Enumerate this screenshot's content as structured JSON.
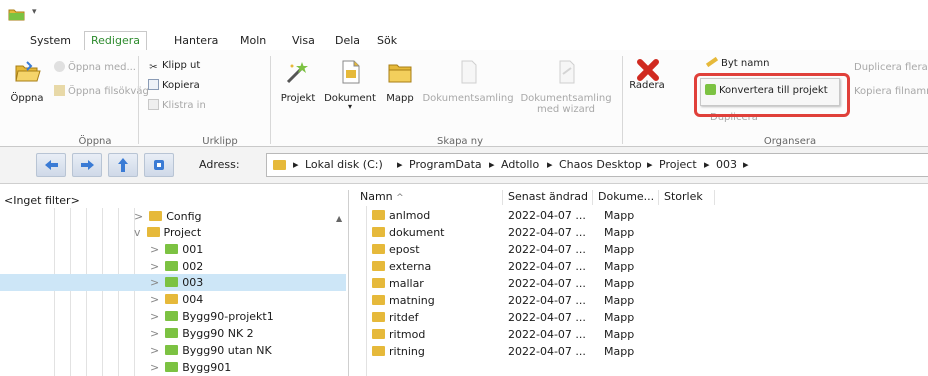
{
  "quick_access": {
    "app_icon": "folder-app-icon",
    "overflow": "▾"
  },
  "tabs": [
    {
      "label": "System"
    },
    {
      "label": "Redigera"
    },
    {
      "label": "Hantera"
    },
    {
      "label": "Moln"
    },
    {
      "label": "Visa"
    },
    {
      "label": "Dela"
    },
    {
      "label": "Sök"
    }
  ],
  "ribbon": {
    "oppna_group": {
      "label": "Öppna",
      "open": "Öppna",
      "open_with": "Öppna med...",
      "open_path": "Öppna filsökväg"
    },
    "urklipp_group": {
      "label": "Urklipp",
      "cut": "Klipp ut",
      "copy": "Kopiera",
      "paste": "Klistra in"
    },
    "skapa_group": {
      "label": "Skapa ny",
      "project": "Projekt",
      "document": "Dokument",
      "folder": "Mapp",
      "doc_collection": "Dokumentsamling",
      "doc_collection_wizard_1": "Dokumentsamling",
      "doc_collection_wizard_2": "med wizard"
    },
    "organisera_group": {
      "label": "Organsera",
      "delete": "Radera",
      "rename": "Byt namn",
      "duplicate": "Duplicera",
      "convert": "Konvertera till projekt",
      "duplicate_multiple": "Duplicera flera",
      "copy_filename": "Kopiera filnamn"
    }
  },
  "nav": {
    "address_label": "Adress:",
    "crumbs": [
      "Lokal disk (C:)",
      "ProgramData",
      "Adtollo",
      "Chaos Desktop",
      "Project",
      "003"
    ],
    "sep": "▸"
  },
  "tree": {
    "filter": "<Inget filter>",
    "items": [
      {
        "label": "Config",
        "expander": ">"
      },
      {
        "label": "Project",
        "expander": "v"
      },
      {
        "label": "001",
        "expander": ">"
      },
      {
        "label": "002",
        "expander": ">"
      },
      {
        "label": "003",
        "expander": ">"
      },
      {
        "label": "004",
        "expander": ">"
      },
      {
        "label": "Bygg90-projekt1",
        "expander": ">"
      },
      {
        "label": "Bygg90 NK 2",
        "expander": ">"
      },
      {
        "label": "Bygg90 utan NK",
        "expander": ">"
      },
      {
        "label": "Bygg901",
        "expander": ">"
      }
    ],
    "scroll_up": "▲"
  },
  "files": {
    "headers": {
      "name": "Namn",
      "sort": "^",
      "modified": "Senast ändrad",
      "type": "Dokume...",
      "size": "Storlek"
    },
    "rows": [
      {
        "name": "anlmod",
        "modified": "2022-04-07 ...",
        "type": "Mapp"
      },
      {
        "name": "dokument",
        "modified": "2022-04-07 ...",
        "type": "Mapp"
      },
      {
        "name": "epost",
        "modified": "2022-04-07 ...",
        "type": "Mapp"
      },
      {
        "name": "externa",
        "modified": "2022-04-07 ...",
        "type": "Mapp"
      },
      {
        "name": "mallar",
        "modified": "2022-04-07 ...",
        "type": "Mapp"
      },
      {
        "name": "matning",
        "modified": "2022-04-07 ...",
        "type": "Mapp"
      },
      {
        "name": "ritdef",
        "modified": "2022-04-07 ...",
        "type": "Mapp"
      },
      {
        "name": "ritmod",
        "modified": "2022-04-07 ...",
        "type": "Mapp"
      },
      {
        "name": "ritning",
        "modified": "2022-04-07 ...",
        "type": "Mapp"
      }
    ]
  },
  "colors": {
    "accent_green": "#2e8b2e",
    "folder_yellow": "#e9c64a",
    "folder_green": "#7cc242",
    "selection": "#cde6f7",
    "highlight_red": "#e0403a"
  }
}
